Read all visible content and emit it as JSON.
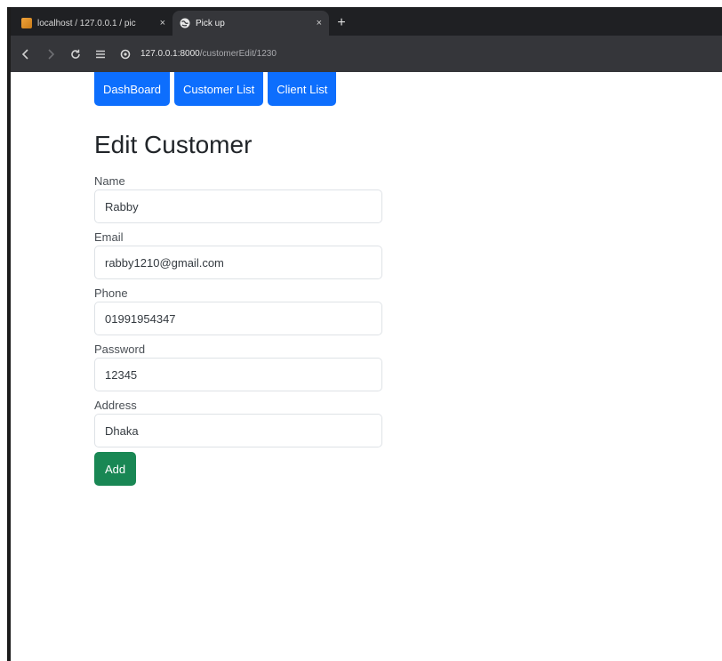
{
  "browser": {
    "tabs": [
      {
        "title": "localhost / 127.0.0.1 / pic",
        "close": "×",
        "active": false
      },
      {
        "title": "Pick up",
        "close": "×",
        "active": true
      }
    ],
    "new_tab": "+",
    "url_host": "127.0.0.1:8000",
    "url_path": "/customerEdit/1230"
  },
  "nav": {
    "items": [
      "DashBoard",
      "Customer List",
      "Client List"
    ]
  },
  "page": {
    "title": "Edit Customer"
  },
  "form": {
    "fields": [
      {
        "label": "Name",
        "value": "Rabby"
      },
      {
        "label": "Email",
        "value": "rabby1210@gmail.com"
      },
      {
        "label": "Phone",
        "value": "01991954347"
      },
      {
        "label": "Password",
        "value": "12345"
      },
      {
        "label": "Address",
        "value": "Dhaka"
      }
    ],
    "submit_label": "Add"
  },
  "colors": {
    "primary": "#0d6efd",
    "success": "#198754",
    "browser_toolbar": "#35363a",
    "browser_tabstrip": "#1f2023"
  }
}
